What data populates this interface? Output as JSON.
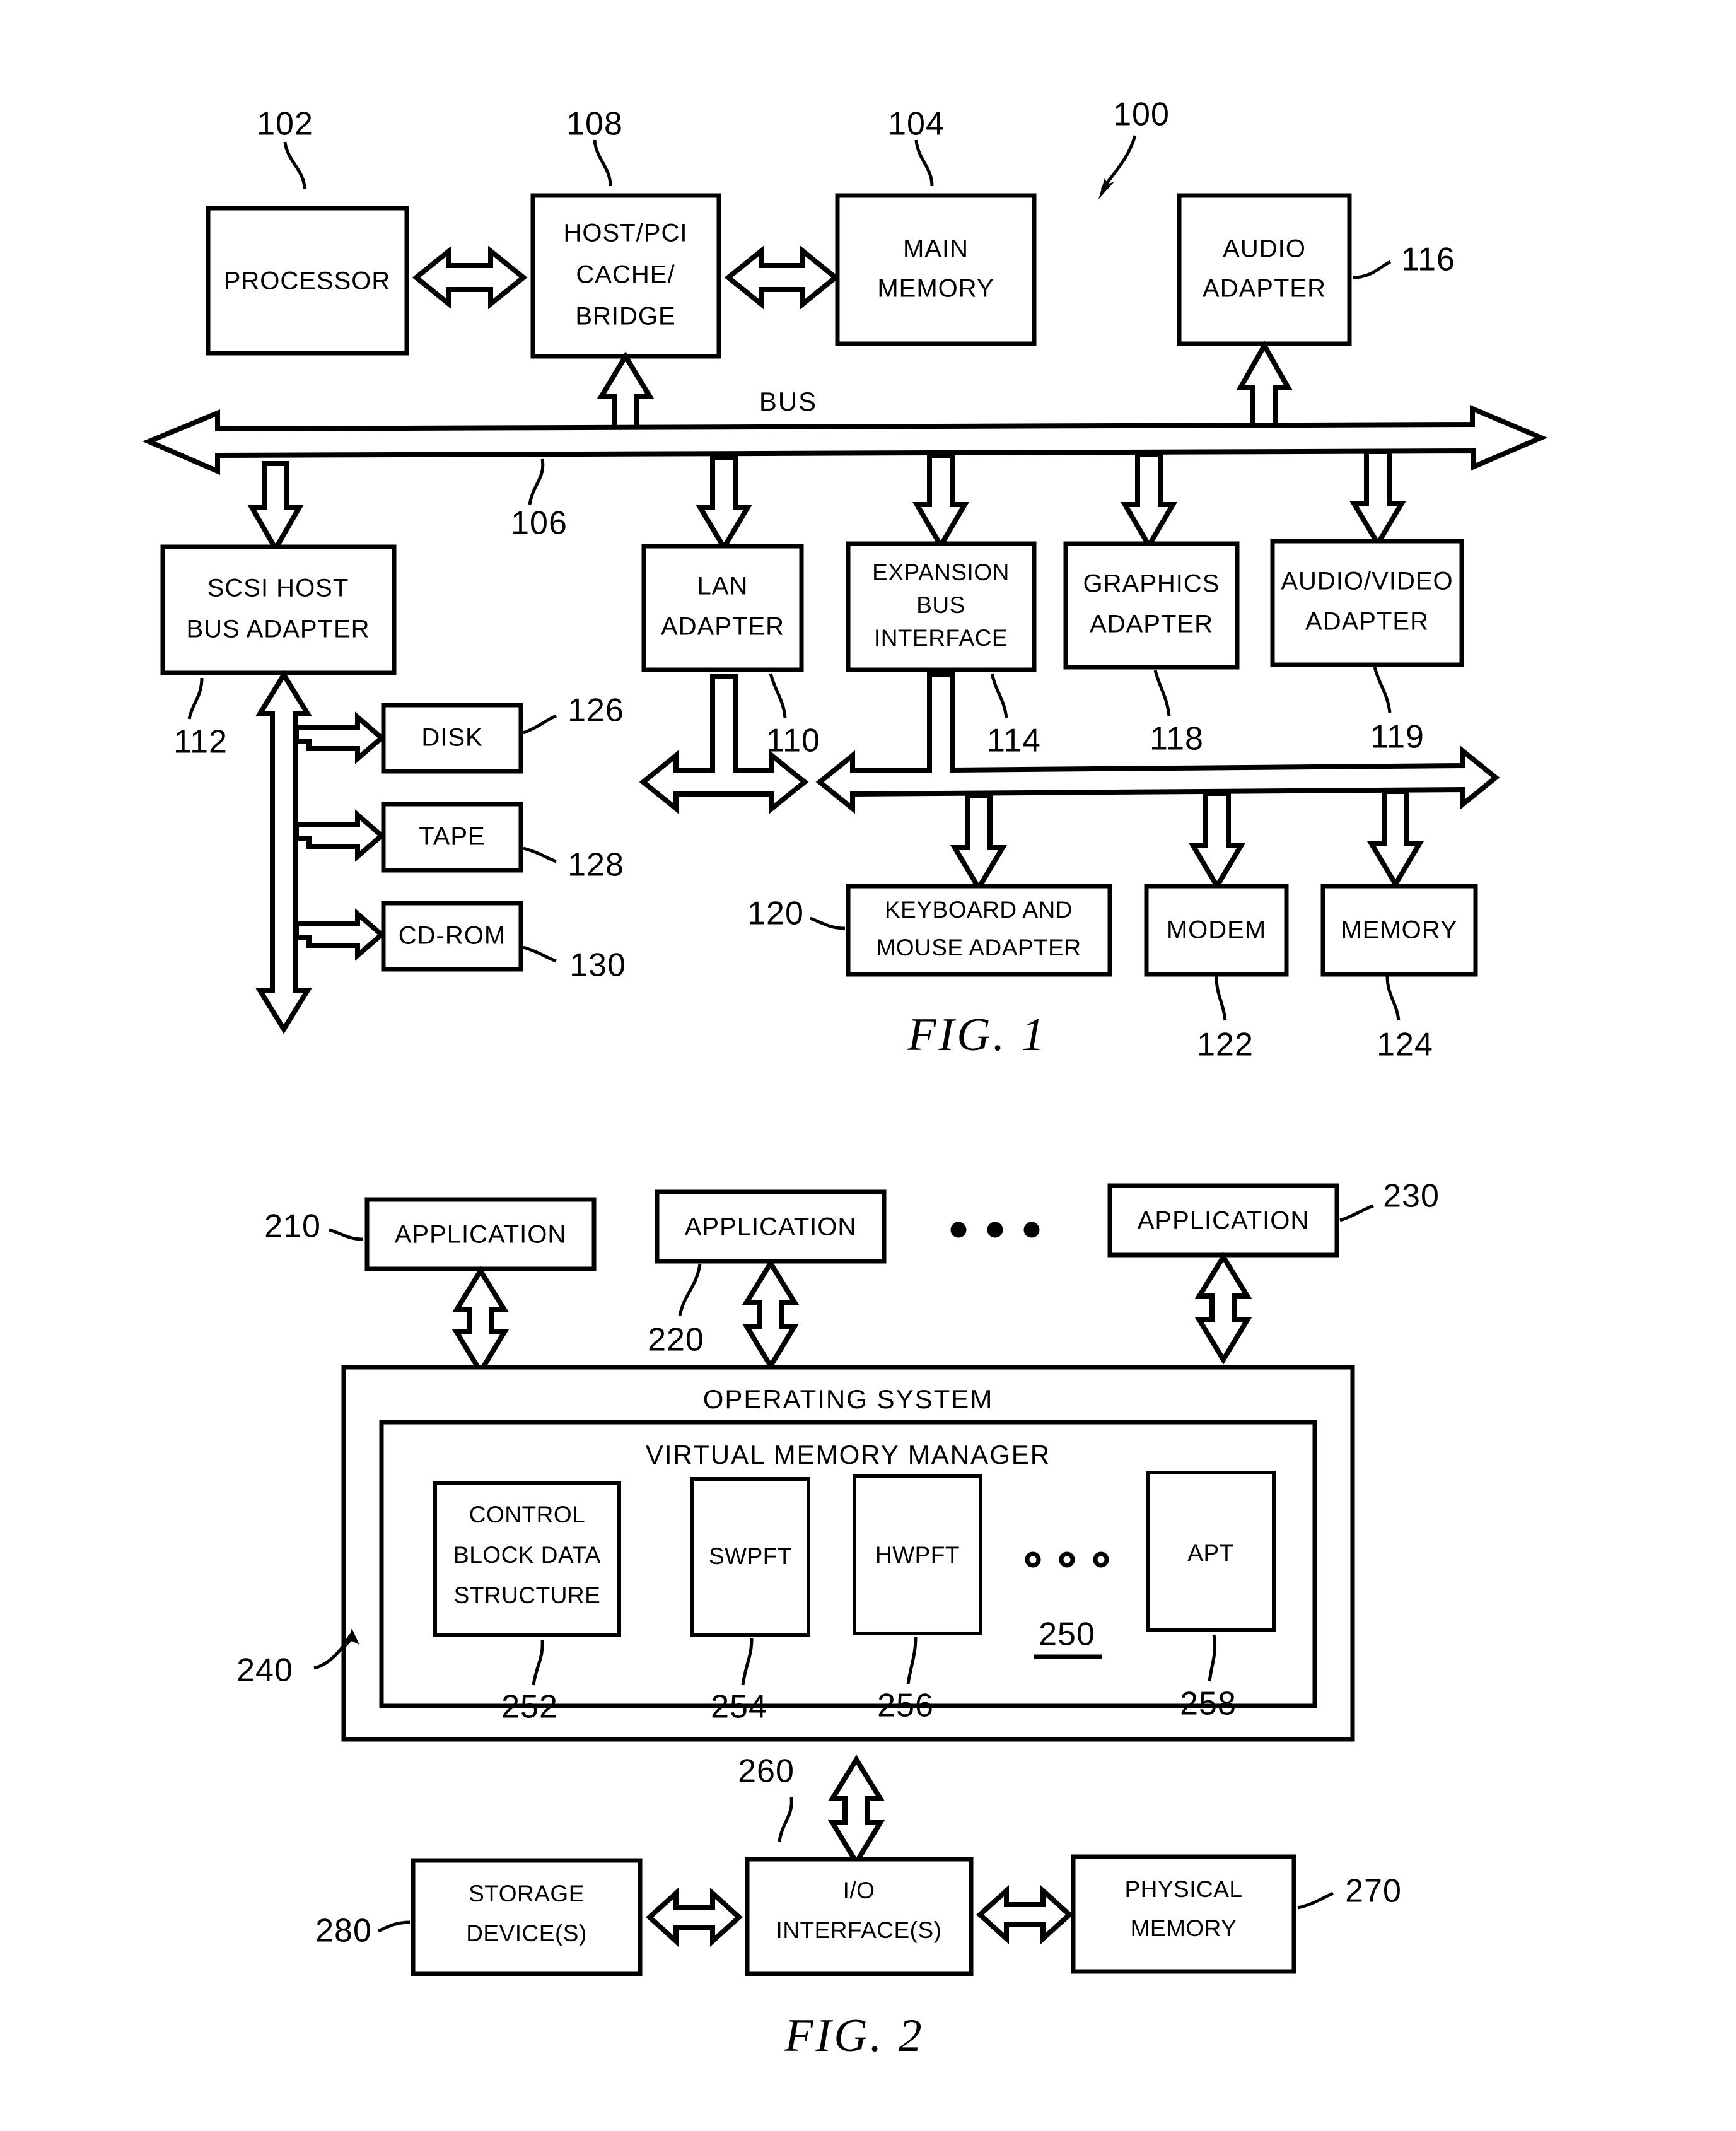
{
  "figures": [
    {
      "id": "fig1",
      "caption": "FIG.  1",
      "system_ref": "100",
      "bus_label": "BUS",
      "bus_ref": "106",
      "blocks": [
        {
          "key": "processor",
          "label": "PROCESSOR",
          "ref": "102"
        },
        {
          "key": "host_pci_bridge",
          "label": "HOST/PCI\nCACHE/\nBRIDGE",
          "ref": "108"
        },
        {
          "key": "main_memory",
          "label": "MAIN\nMEMORY",
          "ref": "104"
        },
        {
          "key": "audio_adapter",
          "label": "AUDIO\nADAPTER",
          "ref": "116"
        },
        {
          "key": "scsi_host_bus_adapter",
          "label": "SCSI HOST\nBUS ADAPTER",
          "ref": "112"
        },
        {
          "key": "lan_adapter",
          "label": "LAN\nADAPTER",
          "ref": "110"
        },
        {
          "key": "expansion_bus_interface",
          "label": "EXPANSION\nBUS\nINTERFACE",
          "ref": "114"
        },
        {
          "key": "graphics_adapter",
          "label": "GRAPHICS\nADAPTER",
          "ref": "118"
        },
        {
          "key": "audio_video_adapter",
          "label": "AUDIO/VIDEO\nADAPTER",
          "ref": "119"
        },
        {
          "key": "disk",
          "label": "DISK",
          "ref": "126"
        },
        {
          "key": "tape",
          "label": "TAPE",
          "ref": "128"
        },
        {
          "key": "cdrom",
          "label": "CD-ROM",
          "ref": "130"
        },
        {
          "key": "keyboard_mouse_adapter",
          "label": "KEYBOARD AND\nMOUSE ADAPTER",
          "ref": "120"
        },
        {
          "key": "modem",
          "label": "MODEM",
          "ref": "122"
        },
        {
          "key": "memory",
          "label": "MEMORY",
          "ref": "124"
        }
      ]
    },
    {
      "id": "fig2",
      "caption": "FIG.  2",
      "ellipsis": "o o o",
      "blocks": [
        {
          "key": "application_1",
          "label": "APPLICATION",
          "ref": "210"
        },
        {
          "key": "application_2",
          "label": "APPLICATION",
          "ref": "220"
        },
        {
          "key": "application_n",
          "label": "APPLICATION",
          "ref": "230"
        },
        {
          "key": "operating_system",
          "label": "OPERATING SYSTEM",
          "ref": "240"
        },
        {
          "key": "virtual_memory_manager",
          "label": "VIRTUAL MEMORY MANAGER",
          "ref": "250"
        },
        {
          "key": "control_block_data_structure",
          "label": "CONTROL\nBLOCK DATA\nSTRUCTURE",
          "ref": "252"
        },
        {
          "key": "swpft",
          "label": "SWPFT",
          "ref": "254"
        },
        {
          "key": "hwpft",
          "label": "HWPFT",
          "ref": "256"
        },
        {
          "key": "apt",
          "label": "APT",
          "ref": "258"
        },
        {
          "key": "io_interfaces",
          "label": "I/O\nINTERFACE(S)",
          "ref": "260"
        },
        {
          "key": "physical_memory",
          "label": "PHYSICAL\nMEMORY",
          "ref": "270"
        },
        {
          "key": "storage_devices",
          "label": "STORAGE\nDEVICE(S)",
          "ref": "280"
        }
      ]
    }
  ],
  "fig1": {
    "caption": "FIG.  1",
    "bus_label": "BUS",
    "system_ref": "100",
    "bus_ref": "106",
    "processor": {
      "l1": "PROCESSOR",
      "ref": "102"
    },
    "bridge": {
      "l1": "HOST/PCI",
      "l2": "CACHE/",
      "l3": "BRIDGE",
      "ref": "108"
    },
    "main_memory": {
      "l1": "MAIN",
      "l2": "MEMORY",
      "ref": "104"
    },
    "audio_adapter": {
      "l1": "AUDIO",
      "l2": "ADAPTER",
      "ref": "116"
    },
    "scsi": {
      "l1": "SCSI HOST",
      "l2": "BUS ADAPTER",
      "ref": "112"
    },
    "lan": {
      "l1": "LAN",
      "l2": "ADAPTER",
      "ref": "110"
    },
    "expansion": {
      "l1": "EXPANSION",
      "l2": "BUS",
      "l3": "INTERFACE",
      "ref": "114"
    },
    "graphics": {
      "l1": "GRAPHICS",
      "l2": "ADAPTER",
      "ref": "118"
    },
    "audio_video": {
      "l1": "AUDIO/VIDEO",
      "l2": "ADAPTER",
      "ref": "119"
    },
    "disk": {
      "l1": "DISK",
      "ref": "126"
    },
    "tape": {
      "l1": "TAPE",
      "ref": "128"
    },
    "cdrom": {
      "l1": "CD-ROM",
      "ref": "130"
    },
    "kbd": {
      "l1": "KEYBOARD AND",
      "l2": "MOUSE ADAPTER",
      "ref": "120"
    },
    "modem": {
      "l1": "MODEM",
      "ref": "122"
    },
    "memory": {
      "l1": "MEMORY",
      "ref": "124"
    }
  },
  "fig2": {
    "caption": "FIG.  2",
    "app1": {
      "l1": "APPLICATION",
      "ref": "210"
    },
    "app2": {
      "l1": "APPLICATION",
      "ref": "220"
    },
    "app3": {
      "l1": "APPLICATION",
      "ref": "230"
    },
    "os": {
      "l1": "OPERATING SYSTEM",
      "ref": "240"
    },
    "vmm": {
      "l1": "VIRTUAL MEMORY MANAGER",
      "ref": "250"
    },
    "cbds": {
      "l1": "CONTROL",
      "l2": "BLOCK DATA",
      "l3": "STRUCTURE",
      "ref": "252"
    },
    "swpft": {
      "l1": "SWPFT",
      "ref": "254"
    },
    "hwpft": {
      "l1": "HWPFT",
      "ref": "256"
    },
    "apt": {
      "l1": "APT",
      "ref": "258"
    },
    "io": {
      "l1": "I/O",
      "l2": "INTERFACE(S)",
      "ref": "260"
    },
    "phys": {
      "l1": "PHYSICAL",
      "l2": "MEMORY",
      "ref": "270"
    },
    "storage": {
      "l1": "STORAGE",
      "l2": "DEVICE(S)",
      "ref": "280"
    }
  }
}
